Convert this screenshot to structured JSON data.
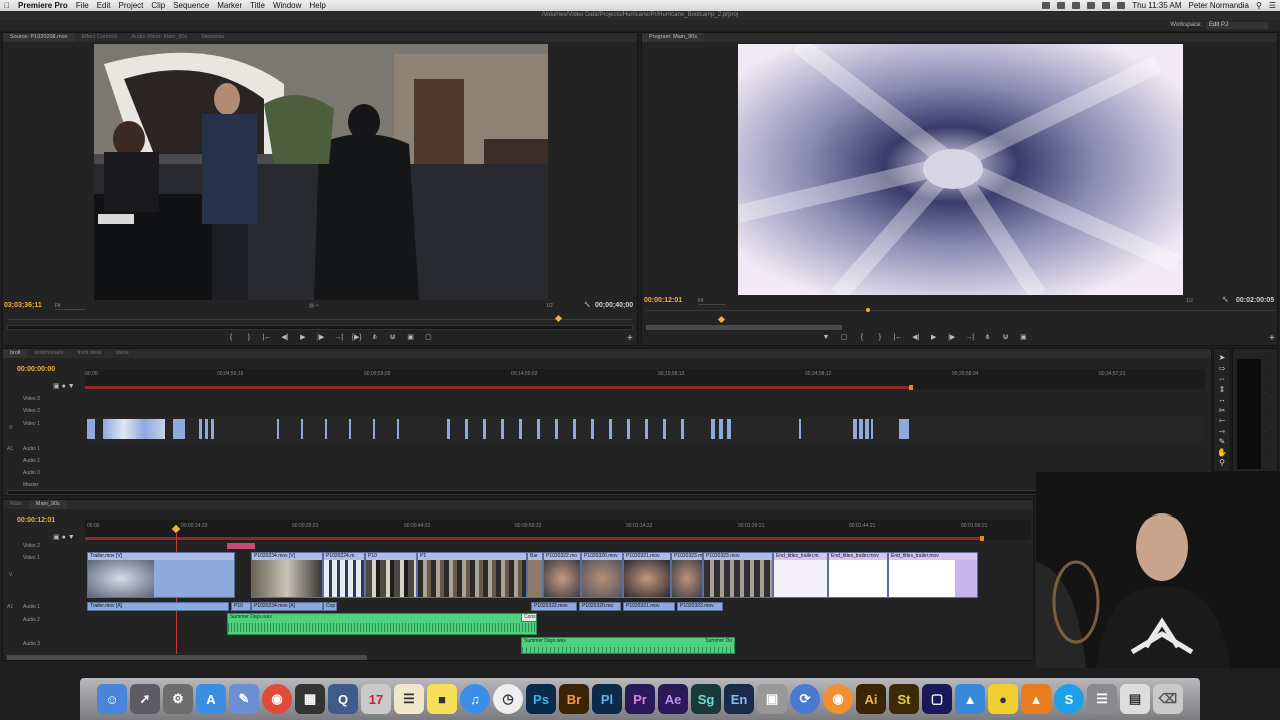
{
  "menubar": {
    "app_name": "Premiere Pro",
    "items": [
      "File",
      "Edit",
      "Project",
      "Clip",
      "Sequence",
      "Marker",
      "Title",
      "Window",
      "Help"
    ],
    "clock": "Thu 11:35 AM",
    "user": "Peter Normandia"
  },
  "title_path": "/Volumes/Video Data/Projects/Hurricane/Pr/Hurricane_Bootcamp_2.prproj",
  "workspace": {
    "label": "Workspace:",
    "value": "Edit PJ"
  },
  "source_monitor": {
    "tabs": [
      "Source: P1020208.mov",
      "Effect Controls",
      "Audio Mixer: Main_90s",
      "Metadata"
    ],
    "timecode_left": "03;03;36;11",
    "fit": "Fit",
    "resolution": "1/2",
    "timecode_right": "00;00;40;00"
  },
  "program_monitor": {
    "tab": "Program: Main_90s",
    "timecode_left": "00:00:12:01",
    "fit": "Fit",
    "resolution": "1/2",
    "timecode_right": "00:02:00:05"
  },
  "upper_timeline": {
    "tabs": [
      "broll",
      "testimonials",
      "front desk",
      "steve"
    ],
    "current_time": "00:00:00:00",
    "ruler": [
      "00;00",
      "00;04;59;16",
      "00;09;59;09",
      "00;14;59;02",
      "00;19;58;19",
      "00;24;58;12",
      "00;29;58;04",
      "00;34;57;21"
    ],
    "tracks": [
      "Video 3",
      "Video 2",
      "Video 1",
      "Audio 1",
      "Audio 2",
      "Audio 3",
      "Master"
    ],
    "track_badges": [
      "V",
      "A1"
    ]
  },
  "lower_timeline": {
    "tabs": [
      "Main",
      "Main_90s"
    ],
    "current_time": "00:00:12:01",
    "ruler": [
      "00:00",
      "00:00:14:23",
      "00:00:29:23",
      "00:00:44:22",
      "00:00:59:22",
      "00:01:14:22",
      "00:01:29:21",
      "00:01:44:21",
      "00:01:59:21"
    ],
    "tracks": [
      "Video 2",
      "Video 1",
      "Audio 1",
      "Audio 2",
      "Audio 3"
    ],
    "track_badges": [
      "V",
      "A1"
    ],
    "video_clips": [
      "Trailer.mov [V]",
      "P1020234.mov [V]",
      "P1020224.m",
      "P10",
      "P1",
      "Bar",
      "P1020322.mo",
      "P1020320.mov",
      "P1020321.mov",
      "P1020323.mov",
      "End_titles_trailer.m",
      "End_titles_trailer.mov",
      "End_titles_trailer.mov"
    ],
    "audio1_clips": [
      "Trailer.mov [A]",
      "P10",
      "P1020234.mov [A]",
      "Cop",
      "P1020322.mov",
      "P1020320.mo",
      "P1020321.mov",
      "P1020323.mov"
    ],
    "audio2_clips": [
      "Summer Days.wav",
      "Cons"
    ],
    "audio3_clips": [
      "Summer Days.wav",
      "Summer Da"
    ]
  },
  "dock": {
    "apps": [
      "Ps",
      "Br",
      "Pl",
      "Pr",
      "Ae",
      "Sg",
      "En",
      "Ai",
      "St"
    ]
  },
  "colors": {
    "timecode": "#e7b43c",
    "video_clip": "#8ea9dc",
    "audio_clip_green": "#4fd07d",
    "premiere_purple": "#2a1a5a"
  }
}
